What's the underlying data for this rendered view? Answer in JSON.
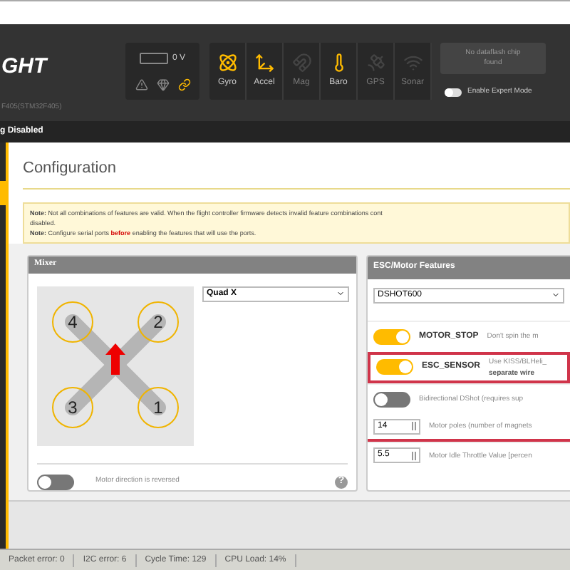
{
  "header": {
    "logo": "GHT",
    "board": "F405(STM32F405)",
    "battery": {
      "reading": "0 V"
    },
    "status_icons": [
      {
        "kind": "warning",
        "active": false
      },
      {
        "kind": "gem",
        "active": false
      },
      {
        "kind": "link",
        "active": true
      }
    ],
    "sensors": [
      {
        "kind": "gyro",
        "label": "Gyro",
        "active": true
      },
      {
        "kind": "accel",
        "label": "Accel",
        "active": true
      },
      {
        "kind": "mag",
        "label": "Mag",
        "active": false
      },
      {
        "kind": "baro",
        "label": "Baro",
        "active": true
      },
      {
        "kind": "gps",
        "label": "GPS",
        "active": false
      },
      {
        "kind": "sonar",
        "label": "Sonar",
        "active": false
      }
    ],
    "dataflash": "No dataflash chip found",
    "expert_mode": {
      "label": "Enable Expert Mode",
      "on": false
    }
  },
  "arming_bar": "g Disabled",
  "page_title": "Configuration",
  "notes": [
    {
      "text": "**Note:** Not all combinations of features are valid. When the flight controller firmware detects invalid feature combinations cont"
    },
    {
      "text": "disabled."
    },
    {
      "text": "**Note:** Configure serial ports",
      "warning": "before",
      "text_after": "enabling the features that will use the ports."
    }
  ],
  "mixer": {
    "title": "Mixer",
    "type": "Quad X",
    "motors": [
      "4",
      "2",
      "3",
      "1"
    ],
    "reversed": {
      "label": "Motor direction is reversed",
      "on": false
    },
    "help": "?"
  },
  "esc": {
    "title": "ESC/Motor Features",
    "protocol": "DSHOT600",
    "rows": [
      {
        "kind": "toggle",
        "on": true,
        "name": "MOTOR_STOP",
        "description": "Don't spin the m",
        "highlighted": false
      },
      {
        "kind": "toggle",
        "on": true,
        "name": "ESC_SENSOR",
        "description": "Use KISS/BLHeli_",
        "description_bold": "separate wire",
        "highlighted": true
      },
      {
        "kind": "toggle",
        "on": false,
        "description": "Bidirectional DShot (requires sup",
        "highlighted": false
      },
      {
        "kind": "number",
        "value": "14",
        "description": "Motor poles (number of magnets",
        "highlighted": true
      },
      {
        "kind": "number",
        "value": "5.5",
        "description": "Motor Idle Throttle Value [percen",
        "highlighted": false
      }
    ]
  },
  "status_bar": [
    "Packet error: 0",
    "I2C error: 6",
    "Cycle Time: 129",
    "CPU Load: 14%"
  ]
}
